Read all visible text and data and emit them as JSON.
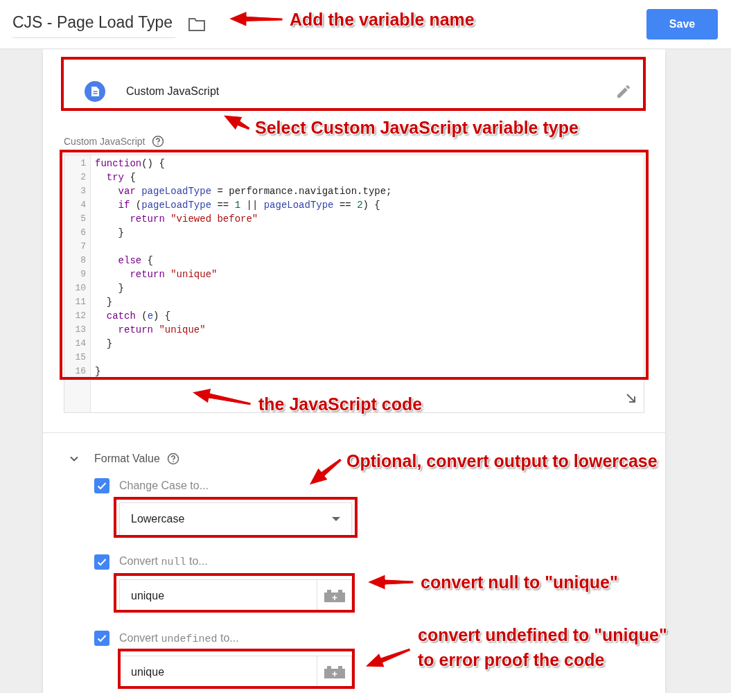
{
  "header": {
    "variable_name": "CJS - Page Load Type",
    "save_button": "Save"
  },
  "variable_type": {
    "label": "Custom JavaScript"
  },
  "code_editor": {
    "label": "Custom JavaScript",
    "lines": [
      {
        "number": "1",
        "tokens": [
          {
            "text": "function",
            "kind": "keyword"
          },
          {
            "text": "() {",
            "kind": "plain"
          }
        ]
      },
      {
        "number": "2",
        "tokens": [
          {
            "text": "  try",
            "kind": "keyword"
          },
          {
            "text": " {",
            "kind": "plain"
          }
        ]
      },
      {
        "number": "3",
        "tokens": [
          {
            "text": "    var ",
            "kind": "keyword"
          },
          {
            "text": "pageLoadType",
            "kind": "variable"
          },
          {
            "text": " = performance.navigation.type;",
            "kind": "plain"
          }
        ]
      },
      {
        "number": "4",
        "tokens": [
          {
            "text": "    if",
            "kind": "keyword"
          },
          {
            "text": " (",
            "kind": "plain"
          },
          {
            "text": "pageLoadType",
            "kind": "variable"
          },
          {
            "text": " == ",
            "kind": "plain"
          },
          {
            "text": "1",
            "kind": "number"
          },
          {
            "text": " || ",
            "kind": "plain"
          },
          {
            "text": "pageLoadType",
            "kind": "variable"
          },
          {
            "text": " == ",
            "kind": "plain"
          },
          {
            "text": "2",
            "kind": "number"
          },
          {
            "text": ") {",
            "kind": "plain"
          }
        ]
      },
      {
        "number": "5",
        "tokens": [
          {
            "text": "      return ",
            "kind": "keyword"
          },
          {
            "text": "\"viewed before\"",
            "kind": "string"
          }
        ]
      },
      {
        "number": "6",
        "tokens": [
          {
            "text": "    }",
            "kind": "plain"
          }
        ]
      },
      {
        "number": "7"
      },
      {
        "number": "8",
        "tokens": [
          {
            "text": "    else",
            "kind": "keyword"
          },
          {
            "text": " {",
            "kind": "plain"
          }
        ]
      },
      {
        "number": "9",
        "tokens": [
          {
            "text": "      return ",
            "kind": "keyword"
          },
          {
            "text": "\"unique\"",
            "kind": "string"
          }
        ]
      },
      {
        "number": "10",
        "tokens": [
          {
            "text": "    }",
            "kind": "plain"
          }
        ]
      },
      {
        "number": "11",
        "tokens": [
          {
            "text": "  }",
            "kind": "plain"
          }
        ]
      },
      {
        "number": "12",
        "tokens": [
          {
            "text": "  catch",
            "kind": "keyword"
          },
          {
            "text": " (",
            "kind": "plain"
          },
          {
            "text": "e",
            "kind": "variable"
          },
          {
            "text": ") {",
            "kind": "plain"
          }
        ]
      },
      {
        "number": "13",
        "tokens": [
          {
            "text": "    return ",
            "kind": "keyword"
          },
          {
            "text": "\"unique\"",
            "kind": "string"
          }
        ]
      },
      {
        "number": "14",
        "tokens": [
          {
            "text": "  }",
            "kind": "plain"
          }
        ]
      },
      {
        "number": "15"
      },
      {
        "number": "16",
        "tokens": [
          {
            "text": "}",
            "kind": "plain"
          }
        ]
      }
    ]
  },
  "format_value": {
    "title": "Format Value",
    "expanded": true,
    "options": [
      {
        "kind": "select",
        "checked": true,
        "label": [
          {
            "text": "Change Case to...",
            "kind": "plain"
          }
        ],
        "value": "Lowercase"
      },
      {
        "kind": "text",
        "checked": true,
        "label": [
          {
            "text": "Convert ",
            "kind": "plain"
          },
          {
            "text": "null",
            "kind": "code"
          },
          {
            "text": " to...",
            "kind": "plain"
          }
        ],
        "value": "unique"
      },
      {
        "kind": "text",
        "checked": true,
        "label": [
          {
            "text": "Convert ",
            "kind": "plain"
          },
          {
            "text": "undefined",
            "kind": "code"
          },
          {
            "text": " to...",
            "kind": "plain"
          }
        ],
        "value": "unique"
      }
    ]
  },
  "annotations": [
    {
      "lines": [
        "Add the variable name"
      ]
    },
    {
      "lines": [
        "Select Custom JavaScript variable type"
      ]
    },
    {
      "lines": [
        "the JavaScript code"
      ]
    },
    {
      "lines": [
        "Optional, convert output to lowercase"
      ]
    },
    {
      "lines": [
        "convert null to \"unique\""
      ]
    },
    {
      "lines": [
        "convert undefined to \"unique\"",
        "to error proof the code"
      ]
    }
  ]
}
